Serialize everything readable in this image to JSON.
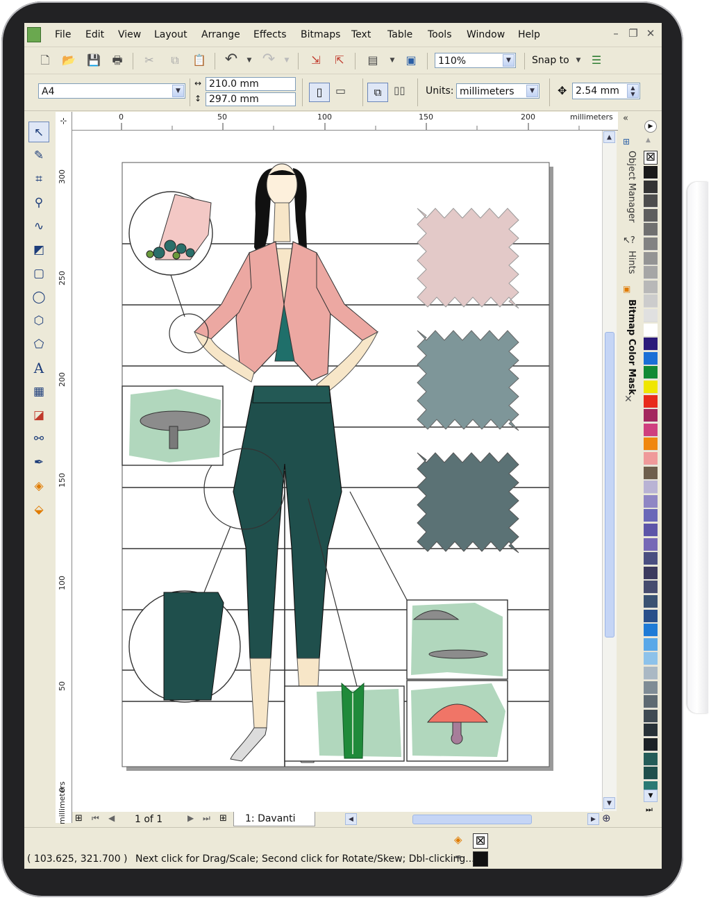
{
  "menu": [
    "File",
    "Edit",
    "View",
    "Layout",
    "Arrange",
    "Effects",
    "Bitmaps",
    "Text",
    "Table",
    "Tools",
    "Window",
    "Help"
  ],
  "toolbar": {
    "zoom": "110%",
    "snap_to": "Snap to"
  },
  "property_bar": {
    "page_size": "A4",
    "width": "210.0 mm",
    "height": "297.0 mm",
    "units_label": "Units:",
    "units": "millimeters",
    "nudge": "2.54 mm"
  },
  "ruler": {
    "h_labels": [
      "0",
      "50",
      "100",
      "150",
      "200"
    ],
    "h_unit": "millimeters",
    "v_labels": [
      "300",
      "250",
      "200",
      "150",
      "100",
      "50",
      "0"
    ],
    "v_unit": "millimeters"
  },
  "page_nav": {
    "page_info": "1 of 1",
    "page_tab": "1: Davanti"
  },
  "dockers": {
    "object_manager": "Object Manager",
    "hints": "Hints",
    "bitmap_color_mask": "Bitmap Color Mask"
  },
  "status": {
    "coords": "( 103.625, 321.700 )",
    "message": "Next click for Drag/Scale; Second click for Rotate/Skew; Dbl-clicking..."
  },
  "palette_colors": [
    "#1a1a1a",
    "#333333",
    "#4d4d4d",
    "#5e5e5e",
    "#707070",
    "#828282",
    "#949494",
    "#a6a6a6",
    "#b8b8b8",
    "#cccccc",
    "#e0e0e0",
    "#ffffff",
    "#2b1a7a",
    "#1a6fd6",
    "#128a34",
    "#efe600",
    "#e82a1c",
    "#a3275e",
    "#cf3f7f",
    "#f0870f",
    "#ef9a9a",
    "#6e5f4d",
    "#b9b3d4",
    "#8f86c4",
    "#6a68b8",
    "#5d55a8",
    "#7668b6",
    "#4a4e80",
    "#3c3a5e",
    "#464c6e",
    "#3a5272",
    "#294f8a",
    "#1f7bd6",
    "#59a8e8",
    "#8dc2ea",
    "#aab8c4",
    "#7f8c95",
    "#5e6a72",
    "#3f4a52",
    "#283238",
    "#1c2226",
    "#245c58",
    "#1f4f4c",
    "#2a7a73"
  ]
}
